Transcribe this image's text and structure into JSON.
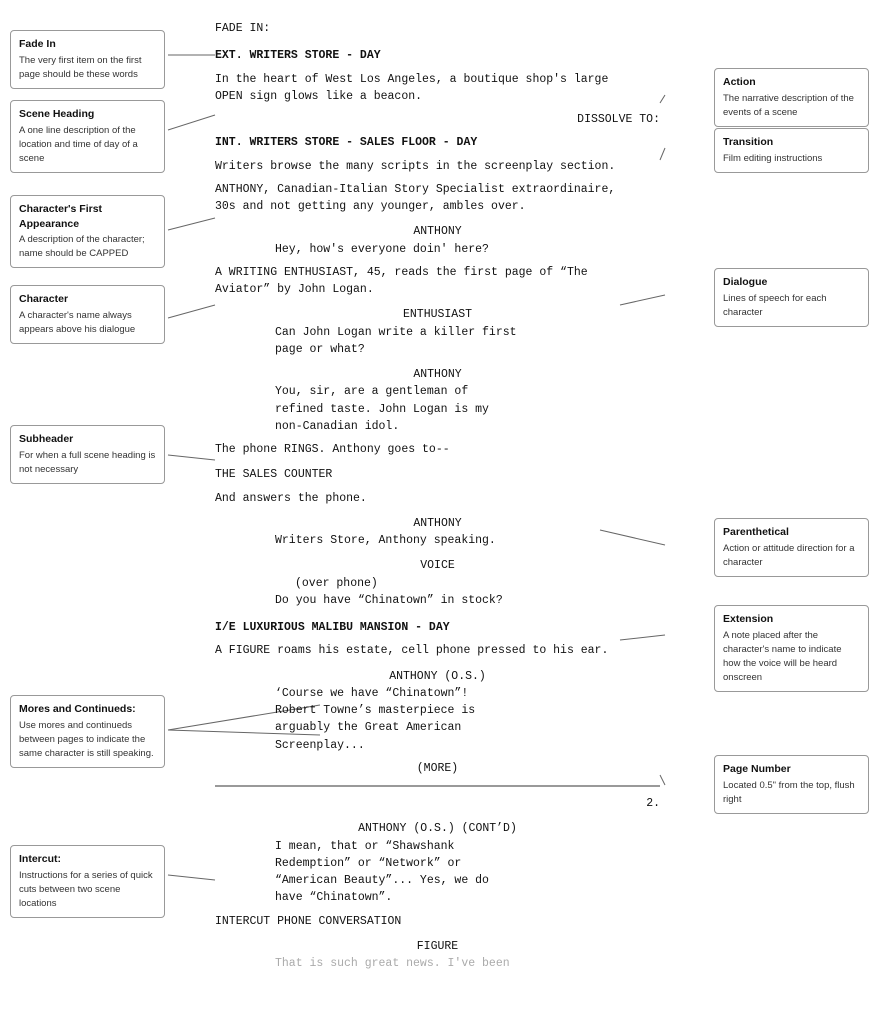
{
  "annotations": {
    "fade_in": {
      "title": "Fade In",
      "desc": "The very first item on the first page should be these words"
    },
    "scene_heading": {
      "title": "Scene Heading",
      "desc": "A one line description of the location and time of day of a scene"
    },
    "character_first": {
      "title": "Character's First Appearance",
      "desc": "A description of the character; name should be CAPPED"
    },
    "character": {
      "title": "Character",
      "desc": "A character's name always appears above his dialogue"
    },
    "subheader": {
      "title": "Subheader",
      "desc": "For when a full scene heading is not necessary"
    },
    "mores": {
      "title": "Mores and Continueds:",
      "desc": "Use mores and continueds between pages to indicate the same character is still speaking."
    },
    "intercut": {
      "title": "Intercut:",
      "desc": "Instructions for a series of quick cuts between two scene locations"
    },
    "action": {
      "title": "Action",
      "desc": "The narrative description of the events of a scene"
    },
    "transition": {
      "title": "Transition",
      "desc": "Film editing instructions"
    },
    "dialogue": {
      "title": "Dialogue",
      "desc": "Lines of speech for each character"
    },
    "parenthetical": {
      "title": "Parenthetical",
      "desc": "Action or attitude direction for a character"
    },
    "extension": {
      "title": "Extension",
      "desc": "A note placed after the character's name to indicate how the voice will be heard onscreen"
    },
    "page_number": {
      "title": "Page Number",
      "desc": "Located 0.5\" from the top, flush right"
    }
  },
  "screenplay": {
    "lines": [
      {
        "type": "fade-in",
        "text": "FADE IN:"
      },
      {
        "type": "scene-heading",
        "text": "EXT. WRITERS STORE - DAY"
      },
      {
        "type": "action",
        "text": "In the heart of West Los Angeles, a boutique shop's large\nOPEN sign glows like a beacon."
      },
      {
        "type": "transition",
        "text": "DISSOLVE TO:"
      },
      {
        "type": "scene-heading",
        "text": "INT. WRITERS STORE - SALES FLOOR - DAY"
      },
      {
        "type": "action",
        "text": "Writers browse the many scripts in the screenplay section."
      },
      {
        "type": "action",
        "text": "ANTHONY, Canadian-Italian Story Specialist extraordinaire,\n30s and not getting any younger, ambles over."
      },
      {
        "type": "character",
        "text": "ANTHONY"
      },
      {
        "type": "dialogue",
        "text": "Hey, how's everyone doin' here?"
      },
      {
        "type": "action",
        "text": "A WRITING ENTHUSIAST, 45, reads the first page of “The\nAviator” by John Logan."
      },
      {
        "type": "character",
        "text": "ENTHUSIAST"
      },
      {
        "type": "dialogue",
        "text": "Can John Logan write a killer first\npage or what?"
      },
      {
        "type": "character",
        "text": "ANTHONY"
      },
      {
        "type": "dialogue",
        "text": "You, sir, are a gentleman of\nrefined taste.  John Logan is my\nnon-Canadian idol."
      },
      {
        "type": "action",
        "text": "The phone RINGS.  Anthony goes to--"
      },
      {
        "type": "subheader",
        "text": "THE SALES COUNTER"
      },
      {
        "type": "action",
        "text": "And answers the phone."
      },
      {
        "type": "character",
        "text": "ANTHONY"
      },
      {
        "type": "dialogue",
        "text": "Writers Store, Anthony speaking."
      },
      {
        "type": "character",
        "text": "VOICE"
      },
      {
        "type": "parenthetical",
        "text": "(over phone)"
      },
      {
        "type": "dialogue",
        "text": "Do you have “Chinatown” in stock?"
      },
      {
        "type": "scene-heading",
        "text": "I/E LUXURIOUS MALIBU MANSION - DAY"
      },
      {
        "type": "action",
        "text": "A FIGURE roams his estate, cell phone pressed to his ear."
      },
      {
        "type": "character",
        "text": "ANTHONY (O.S.)"
      },
      {
        "type": "dialogue",
        "text": "‘Course we have “Chinatown”!\nRobert Towne’s masterpiece is\narguably the Great American\nScreenplay..."
      },
      {
        "type": "more",
        "text": "(MORE)"
      },
      {
        "type": "divider",
        "text": ""
      },
      {
        "type": "page-number",
        "text": "2."
      },
      {
        "type": "character",
        "text": "ANTHONY (O.S.) (CONT’D)"
      },
      {
        "type": "dialogue",
        "text": "I mean, that or “Shawshank\nRedemption” or “Network” or\n“American Beauty”...  Yes, we do\nhave “Chinatown”."
      },
      {
        "type": "intercut",
        "text": "INTERCUT PHONE CONVERSATION"
      },
      {
        "type": "character",
        "text": "FIGURE"
      },
      {
        "type": "dialogue-faded",
        "text": "That is such great news.  I've been"
      }
    ]
  }
}
